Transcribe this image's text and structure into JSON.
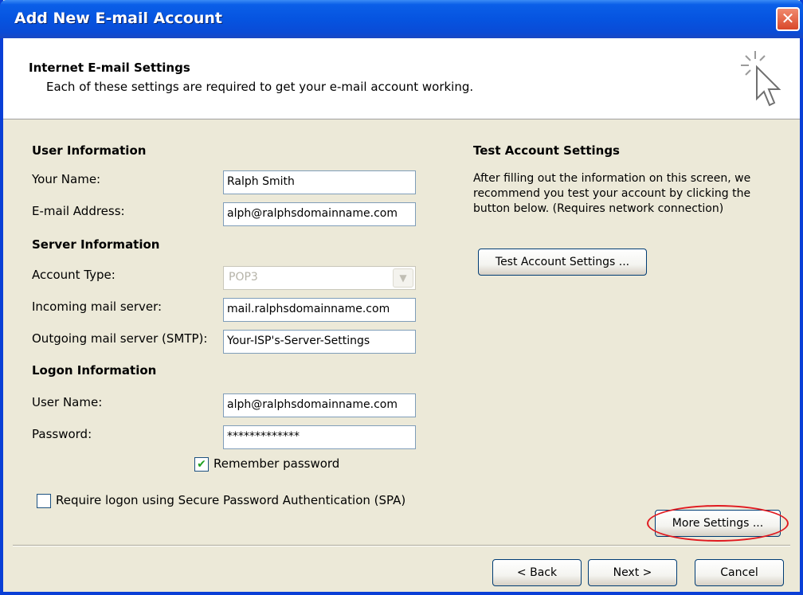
{
  "window": {
    "title": "Add New E-mail Account",
    "close_glyph": "✕"
  },
  "header": {
    "title": "Internet E-mail Settings",
    "subtitle": "Each of these settings are required to get your e-mail account working.",
    "icon": "cursor-sparkle-icon"
  },
  "user_info": {
    "heading": "User Information",
    "name_label": "Your Name:",
    "name_value": "Ralph Smith",
    "email_label": "E-mail Address:",
    "email_value": "alph@ralphsdomainname.com"
  },
  "server_info": {
    "heading": "Server Information",
    "account_type_label": "Account Type:",
    "account_type_value": "POP3",
    "incoming_label": "Incoming mail server:",
    "incoming_value": "mail.ralphsdomainname.com",
    "outgoing_label": "Outgoing mail server (SMTP):",
    "outgoing_value": "Your-ISP's-Server-Settings"
  },
  "logon_info": {
    "heading": "Logon Information",
    "username_label": "User Name:",
    "username_value": "alph@ralphsdomainname.com",
    "password_label": "Password:",
    "password_value": "*************",
    "remember_label": "Remember password",
    "remember_checked": true,
    "spa_label": "Require logon using Secure Password Authentication (SPA)",
    "spa_checked": false
  },
  "test_settings": {
    "heading": "Test Account Settings",
    "line1": "After filling out the information on this screen, we",
    "line2": "recommend you test your account by clicking the",
    "line3": "button below. (Requires network connection)",
    "button_label": "Test Account Settings ..."
  },
  "more_settings_label": "More Settings ...",
  "footer": {
    "back_label": "< Back",
    "next_label": "Next >",
    "cancel_label": "Cancel"
  },
  "colors": {
    "titlebar": "#0654e0",
    "dialog_bg": "#ece9d8",
    "highlight": "#e0191f"
  }
}
